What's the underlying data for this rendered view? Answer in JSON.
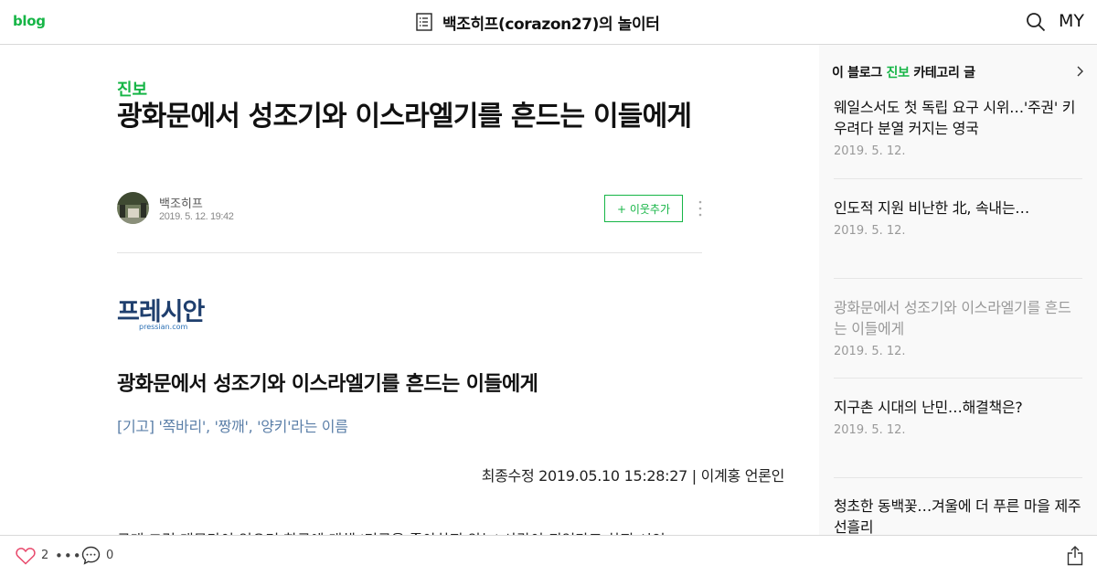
{
  "header": {
    "logo": "blog",
    "title": "백조히프(corazon27)의 놀이터",
    "my_label": "MY"
  },
  "post": {
    "category": "진보",
    "title": "광화문에서 성조기와 이스라엘기를 흔드는 이들에게",
    "author": "백조히프",
    "date": "2019. 5. 12. 19:42",
    "neighbor_button": "+ 이웃추가"
  },
  "article": {
    "source_logo_text": "프레시안",
    "source_logo_sub": "pressian.com",
    "headline": "광화문에서 성조기와 이스라엘기를 흔드는 이들에게",
    "subhead": "[기고] '쪽바리', '짱깨', '양키'라는 이름",
    "meta": "최종수정 2019.05.10 15:28:27 | 이계홍 언론인",
    "body_first_line": "근래 그런 대목만이 있으며 한국에 대해 '미군을 좋아하지 않는' 사람이 되었다고 하지 시인"
  },
  "sidebar": {
    "heading_prefix": "이 블로그",
    "heading_category": "진보",
    "heading_suffix": "카테고리 글",
    "items": [
      {
        "title": "웨일스서도 첫 독립 요구 시위…'주권' 키우려다 분열 커지는 영국",
        "date": "2019. 5. 12.",
        "current": false
      },
      {
        "title": "인도적 지원 비난한 北, 속내는…",
        "date": "2019. 5. 12.",
        "current": false
      },
      {
        "title": "광화문에서 성조기와 이스라엘기를 흔드는 이들에게",
        "date": "2019. 5. 12.",
        "current": true
      },
      {
        "title": "지구촌 시대의 난민…해결책은?",
        "date": "2019. 5. 12.",
        "current": false
      },
      {
        "title": "청초한 동백꽃…겨울에 더 푸른 마을 제주 선흘리",
        "date": "",
        "current": false
      }
    ]
  },
  "bottombar": {
    "like_count": "2",
    "more": "•••",
    "comment_count": "0"
  },
  "colors": {
    "accent_green": "#16b546",
    "link_blue": "#5b7fa8",
    "muted_gray": "#999999"
  }
}
